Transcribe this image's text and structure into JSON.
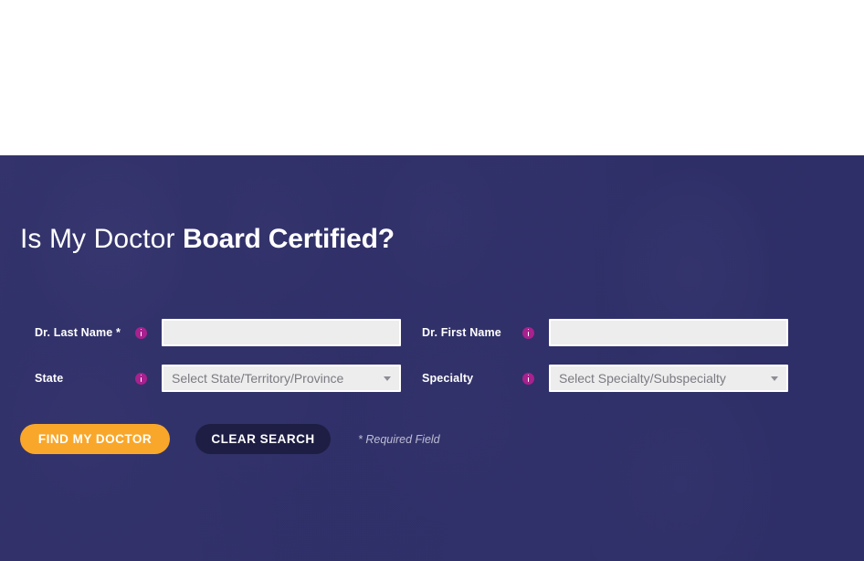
{
  "hero": {
    "title_light": "Is My Doctor ",
    "title_bold": "Board Certified?"
  },
  "form": {
    "fields": [
      {
        "key": "last_name",
        "label": "Dr. Last Name *",
        "info_icon": "info-circle-icon",
        "type": "text",
        "value": "",
        "placeholder": ""
      },
      {
        "key": "first_name",
        "label": "Dr. First Name",
        "info_icon": "info-circle-icon",
        "type": "text",
        "value": "",
        "placeholder": ""
      },
      {
        "key": "state",
        "label": "State",
        "info_icon": "info-circle-icon",
        "type": "select",
        "value": "Select State/Territory/Province",
        "arrow_icon": "chevron-down-icon"
      },
      {
        "key": "specialty",
        "label": "Specialty",
        "info_icon": "info-circle-icon",
        "type": "select",
        "value": "Select Specialty/Subspecialty",
        "arrow_icon": "chevron-down-icon"
      }
    ],
    "buttons": {
      "submit_label": "FIND MY DOCTOR",
      "clear_label": "CLEAR SEARCH"
    },
    "required_note": "* Required Field"
  },
  "colors": {
    "hero_navy": "#2e2e68",
    "button_orange": "#f9a72a",
    "button_dark": "#1e1e44",
    "info_magenta": "#a8218e",
    "input_fill": "#ededed",
    "page_white": "#ffffff"
  }
}
